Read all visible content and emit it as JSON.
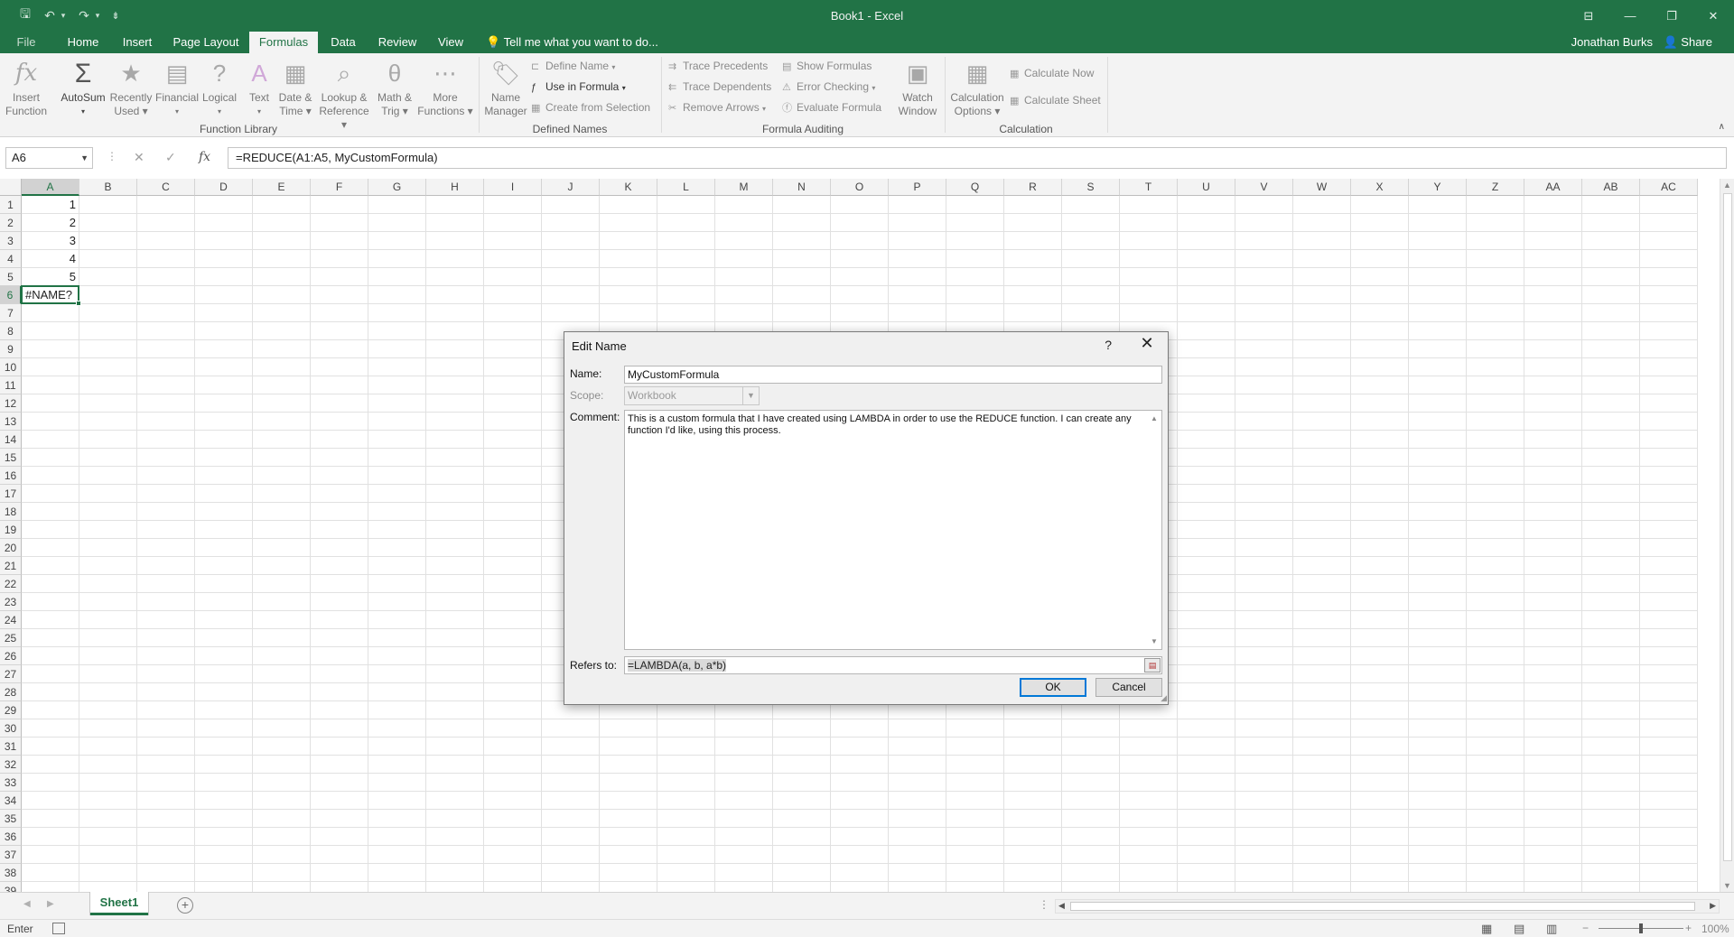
{
  "window": {
    "title": "Book1 - Excel",
    "quick_access": [
      {
        "name": "save-icon",
        "glyph": "🖫"
      },
      {
        "name": "undo-icon",
        "glyph": "↶"
      },
      {
        "name": "undo-dropdown-icon",
        "glyph": "▾"
      },
      {
        "name": "redo-icon",
        "glyph": "↷"
      },
      {
        "name": "redo-dropdown-icon",
        "glyph": "▾"
      },
      {
        "name": "customize-qat-icon",
        "glyph": "⇟"
      }
    ],
    "controls": {
      "ribbon_options": "⊟",
      "minimize": "—",
      "restore": "❐",
      "close": "✕"
    }
  },
  "tabs": [
    "File",
    "Home",
    "Insert",
    "Page Layout",
    "Formulas",
    "Data",
    "Review",
    "View"
  ],
  "active_tab": "Formulas",
  "tell_me": "Tell me what you want to do...",
  "user": "Jonathan Burks",
  "share": "Share",
  "ribbon": {
    "function_library": {
      "label": "Function Library",
      "buttons": [
        {
          "id": "insert-function",
          "line1": "Insert",
          "line2": "Function",
          "icon": "fx"
        },
        {
          "id": "autosum",
          "line1": "AutoSum",
          "line2": "▾",
          "icon": "Σ"
        },
        {
          "id": "recently-used",
          "line1": "Recently",
          "line2": "Used ▾",
          "icon": "★"
        },
        {
          "id": "financial",
          "line1": "Financial",
          "line2": "▾",
          "icon": "▤"
        },
        {
          "id": "logical",
          "line1": "Logical",
          "line2": "▾",
          "icon": "?"
        },
        {
          "id": "text",
          "line1": "Text",
          "line2": "▾",
          "icon": "A"
        },
        {
          "id": "date-time",
          "line1": "Date &",
          "line2": "Time ▾",
          "icon": "▦"
        },
        {
          "id": "lookup-reference",
          "line1": "Lookup &",
          "line2": "Reference ▾",
          "icon": "⌕"
        },
        {
          "id": "math-trig",
          "line1": "Math &",
          "line2": "Trig ▾",
          "icon": "θ"
        },
        {
          "id": "more-functions",
          "line1": "More",
          "line2": "Functions ▾",
          "icon": "⋯"
        }
      ]
    },
    "defined_names": {
      "label": "Defined Names",
      "name_manager": {
        "line1": "Name",
        "line2": "Manager"
      },
      "define_name": "Define Name",
      "use_in_formula": "Use in Formula",
      "create_from_selection": "Create from Selection"
    },
    "formula_auditing": {
      "label": "Formula Auditing",
      "trace_precedents": "Trace Precedents",
      "trace_dependents": "Trace Dependents",
      "remove_arrows": "Remove Arrows",
      "show_formulas": "Show Formulas",
      "error_checking": "Error Checking",
      "evaluate_formula": "Evaluate Formula",
      "watch_window": {
        "line1": "Watch",
        "line2": "Window"
      }
    },
    "calculation": {
      "label": "Calculation",
      "options": {
        "line1": "Calculation",
        "line2": "Options ▾"
      },
      "calculate_now": "Calculate Now",
      "calculate_sheet": "Calculate Sheet"
    }
  },
  "formula_bar": {
    "name_box": "A6",
    "cancel_glyph": "✕",
    "enter_glyph": "✓",
    "fx_glyph": "fx",
    "formula": "=REDUCE(A1:A5, MyCustomFormula)"
  },
  "grid": {
    "columns": [
      "A",
      "B",
      "C",
      "D",
      "E",
      "F",
      "G",
      "H",
      "I",
      "J",
      "K",
      "L",
      "M",
      "N",
      "O",
      "P",
      "Q",
      "R",
      "S",
      "T",
      "U",
      "V",
      "W",
      "X",
      "Y",
      "Z",
      "AA",
      "AB",
      "AC"
    ],
    "row_count": 39,
    "active_cell": "A6",
    "cells": [
      {
        "ref": "A1",
        "row": 1,
        "col": 0,
        "value": "1",
        "type": "num"
      },
      {
        "ref": "A2",
        "row": 2,
        "col": 0,
        "value": "2",
        "type": "num"
      },
      {
        "ref": "A3",
        "row": 3,
        "col": 0,
        "value": "3",
        "type": "num"
      },
      {
        "ref": "A4",
        "row": 4,
        "col": 0,
        "value": "4",
        "type": "num"
      },
      {
        "ref": "A5",
        "row": 5,
        "col": 0,
        "value": "5",
        "type": "num"
      },
      {
        "ref": "A6",
        "row": 6,
        "col": 0,
        "value": "#NAME?",
        "type": "text"
      }
    ]
  },
  "sheets": [
    "Sheet1"
  ],
  "active_sheet": "Sheet1",
  "status": {
    "mode": "Enter",
    "zoom": "100%"
  },
  "dialog": {
    "title": "Edit Name",
    "help": "?",
    "close": "✕",
    "name_label": "Name:",
    "name_value": "MyCustomFormula",
    "scope_label": "Scope:",
    "scope_value": "Workbook",
    "comment_label": "Comment:",
    "comment_value": "This is a custom formula that I have created using LAMBDA in order to use the REDUCE function. I can create any function I'd like, using this process.",
    "refers_label": "Refers to:",
    "refers_value": "=LAMBDA(a, b, a*b)",
    "ok": "OK",
    "cancel": "Cancel"
  },
  "colors": {
    "accent": "#217346",
    "dialog_bg": "#f0f0f0",
    "default_button_border": "#0078d7"
  }
}
